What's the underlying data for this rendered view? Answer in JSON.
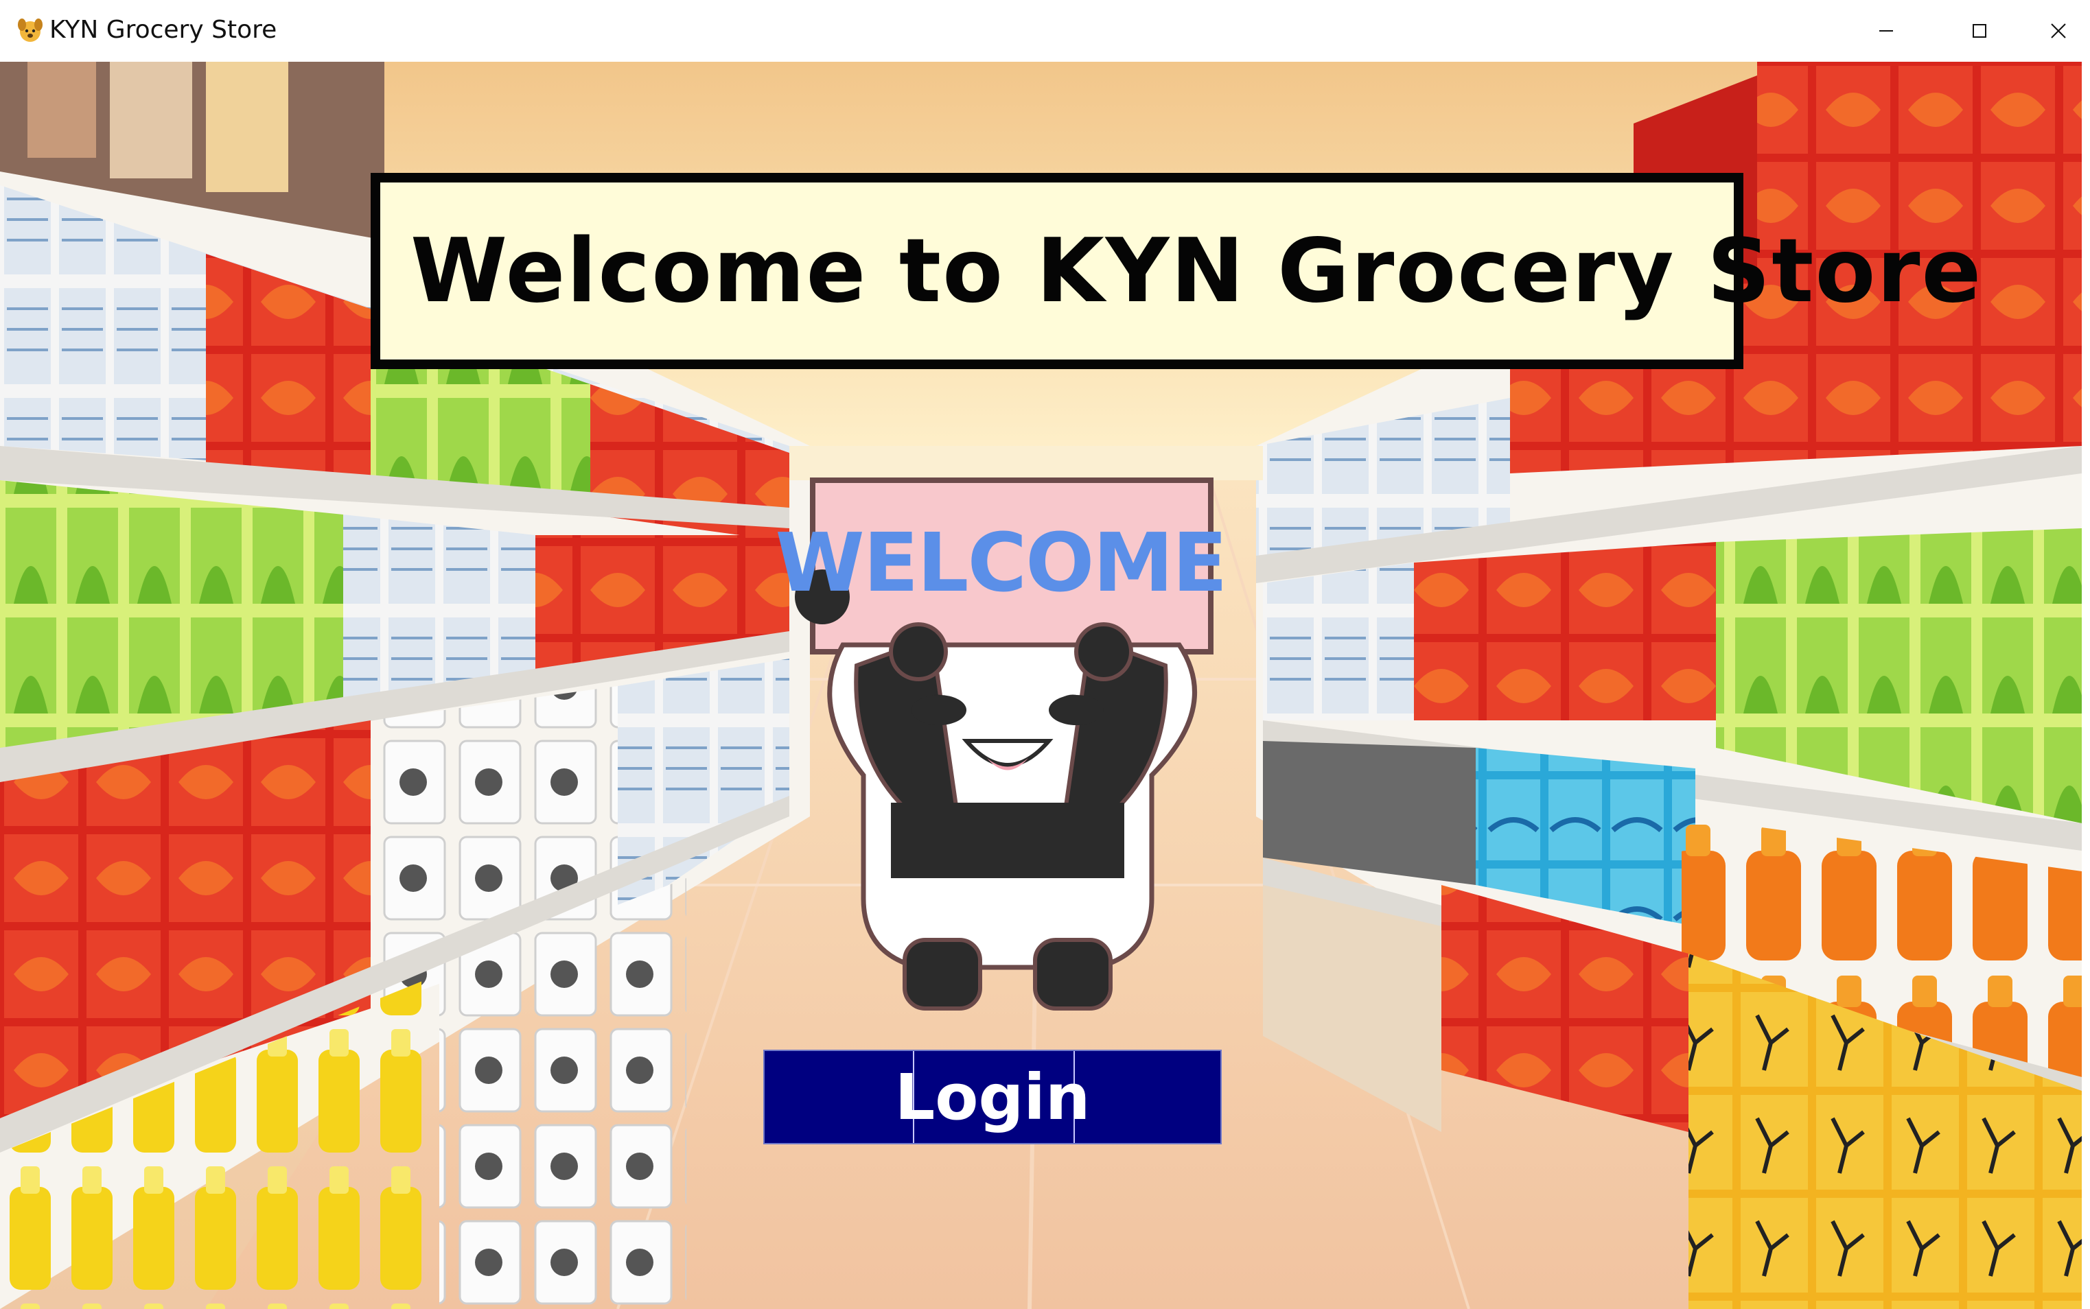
{
  "window": {
    "title": "KYN Grocery Store",
    "icon": "dog-face-icon",
    "controls": [
      "minimize-icon",
      "maximize-icon",
      "close-icon"
    ]
  },
  "banner": {
    "text": "Welcome to KYN Grocery Store"
  },
  "mascot": {
    "sign_text": "WELCOME",
    "icon": "panda-mascot"
  },
  "login": {
    "label": "Login"
  },
  "colors": {
    "banner_bg": "#fffcd9",
    "banner_border": "#050505",
    "sign_text": "#5b8fe8",
    "sign_bg": "#f8c8cc",
    "login_bg": "#000080",
    "login_text": "#ffffff"
  }
}
